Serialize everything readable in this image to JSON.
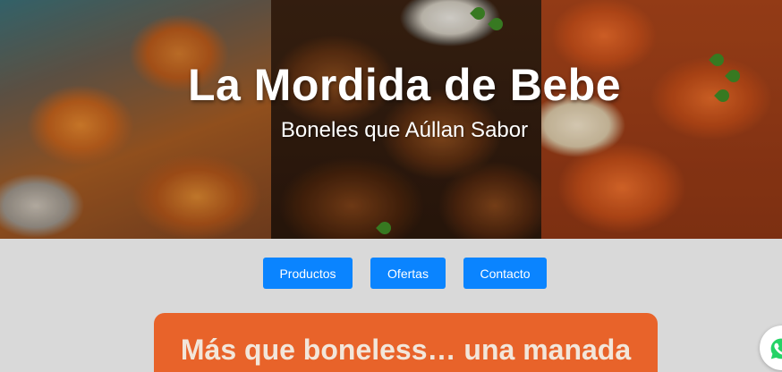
{
  "hero": {
    "title": "La Mordida de Bebe",
    "subtitle": "Boneles que Aúllan Sabor"
  },
  "nav": {
    "items": [
      {
        "label": "Productos"
      },
      {
        "label": "Ofertas"
      },
      {
        "label": "Contacto"
      }
    ],
    "button_color": "#0a84ff"
  },
  "banner": {
    "text": "Más que boneless… una manada",
    "color": "#e8632a"
  },
  "floating": {
    "icon": "whatsapp-icon",
    "icon_color": "#25d366"
  }
}
